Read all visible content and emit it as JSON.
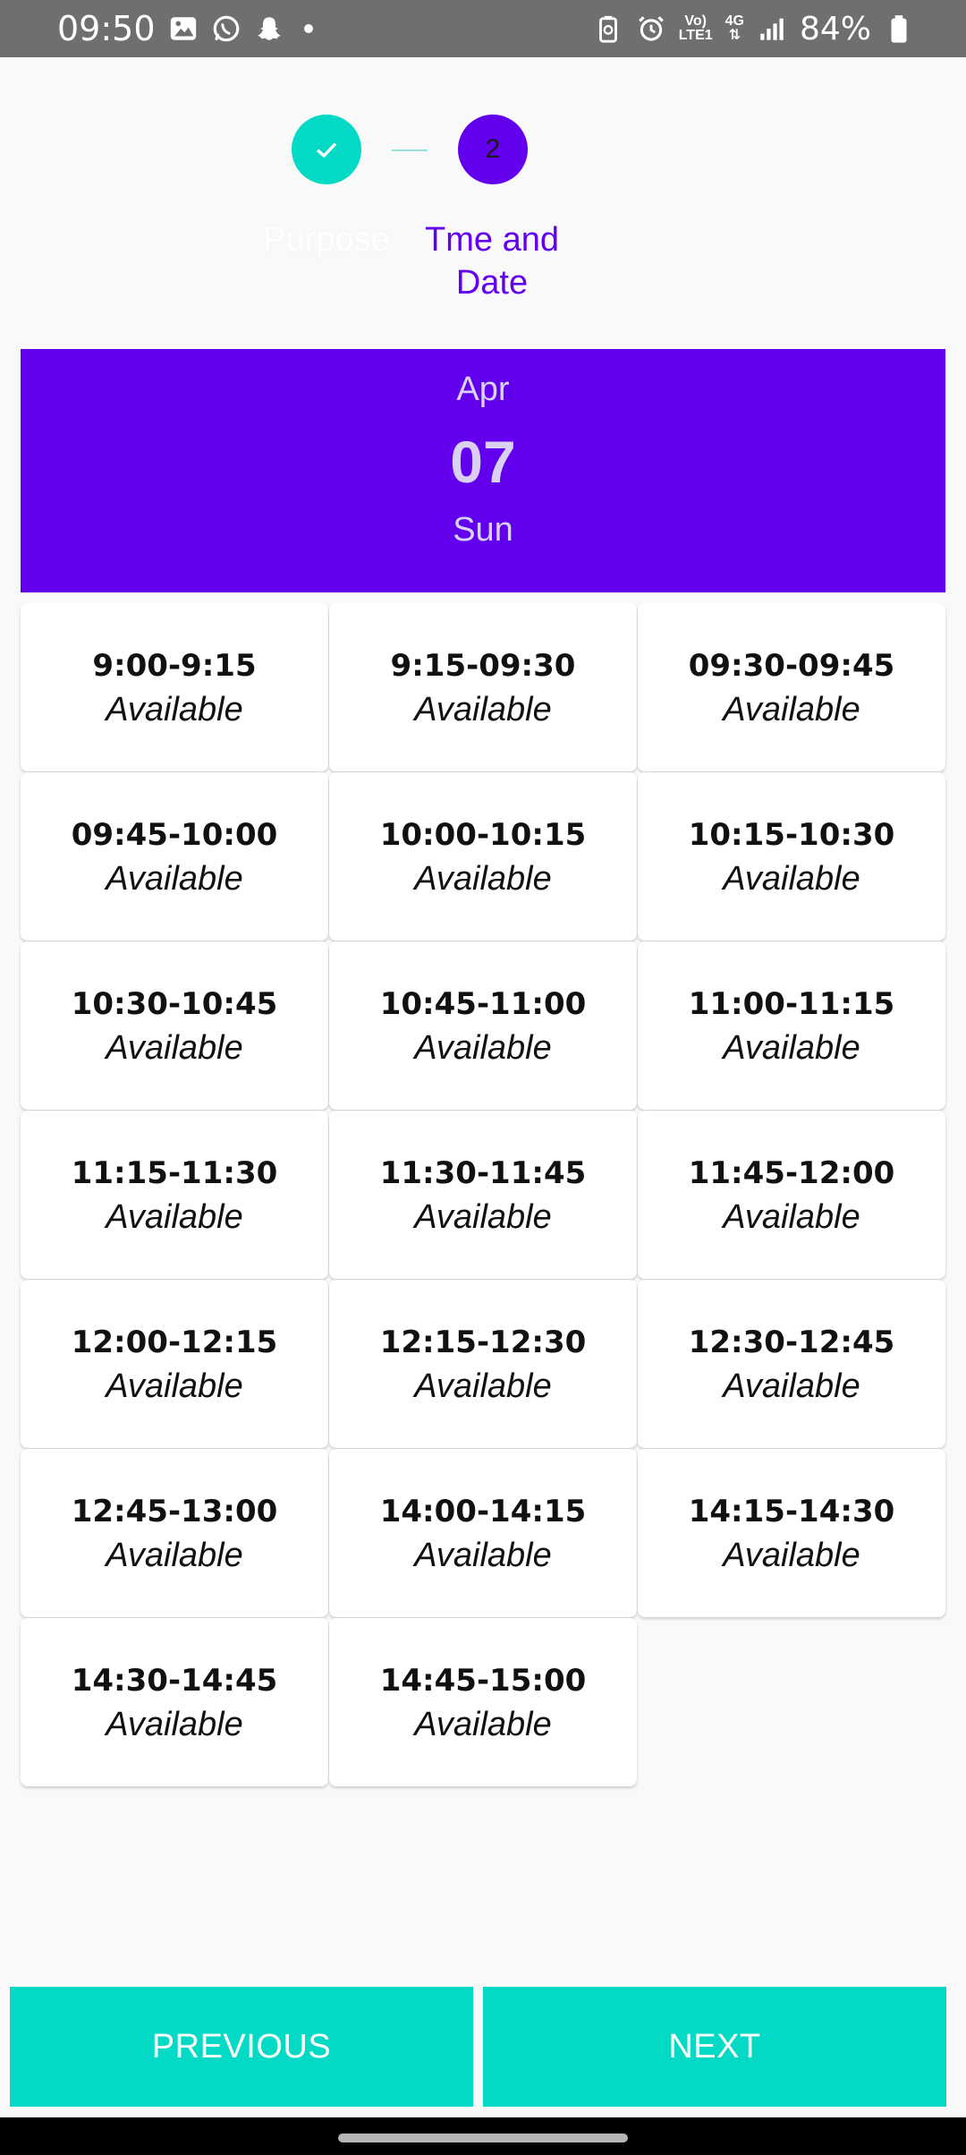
{
  "status_bar": {
    "time": "09:50",
    "network_top": "Vo)",
    "network_bottom": "LTE1",
    "network_type": "4G",
    "battery": "84%"
  },
  "stepper": {
    "steps": [
      {
        "label": "Purpose",
        "state": "completed"
      },
      {
        "label": "Tme and Date",
        "number": "2",
        "state": "active"
      },
      {
        "label": "",
        "state": "pending"
      }
    ]
  },
  "date_header": {
    "month": "Apr",
    "day": "07",
    "weekday": "Sun"
  },
  "slots": [
    {
      "time": "9:00-9:15",
      "status": "Available"
    },
    {
      "time": "9:15-09:30",
      "status": "Available"
    },
    {
      "time": "09:30-09:45",
      "status": "Available"
    },
    {
      "time": "09:45-10:00",
      "status": "Available"
    },
    {
      "time": "10:00-10:15",
      "status": "Available"
    },
    {
      "time": "10:15-10:30",
      "status": "Available"
    },
    {
      "time": "10:30-10:45",
      "status": "Available"
    },
    {
      "time": "10:45-11:00",
      "status": "Available"
    },
    {
      "time": "11:00-11:15",
      "status": "Available"
    },
    {
      "time": "11:15-11:30",
      "status": "Available"
    },
    {
      "time": "11:30-11:45",
      "status": "Available"
    },
    {
      "time": "11:45-12:00",
      "status": "Available"
    },
    {
      "time": "12:00-12:15",
      "status": "Available"
    },
    {
      "time": "12:15-12:30",
      "status": "Available"
    },
    {
      "time": "12:30-12:45",
      "status": "Available"
    },
    {
      "time": "12:45-13:00",
      "status": "Available"
    },
    {
      "time": "14:00-14:15",
      "status": "Available"
    },
    {
      "time": "14:15-14:30",
      "status": "Available"
    },
    {
      "time": "14:30-14:45",
      "status": "Available"
    },
    {
      "time": "14:45-15:00",
      "status": "Available"
    }
  ],
  "buttons": {
    "previous": "PREVIOUS",
    "next": "NEXT"
  },
  "colors": {
    "primary": "#6200ee",
    "accent": "#03dac5"
  }
}
